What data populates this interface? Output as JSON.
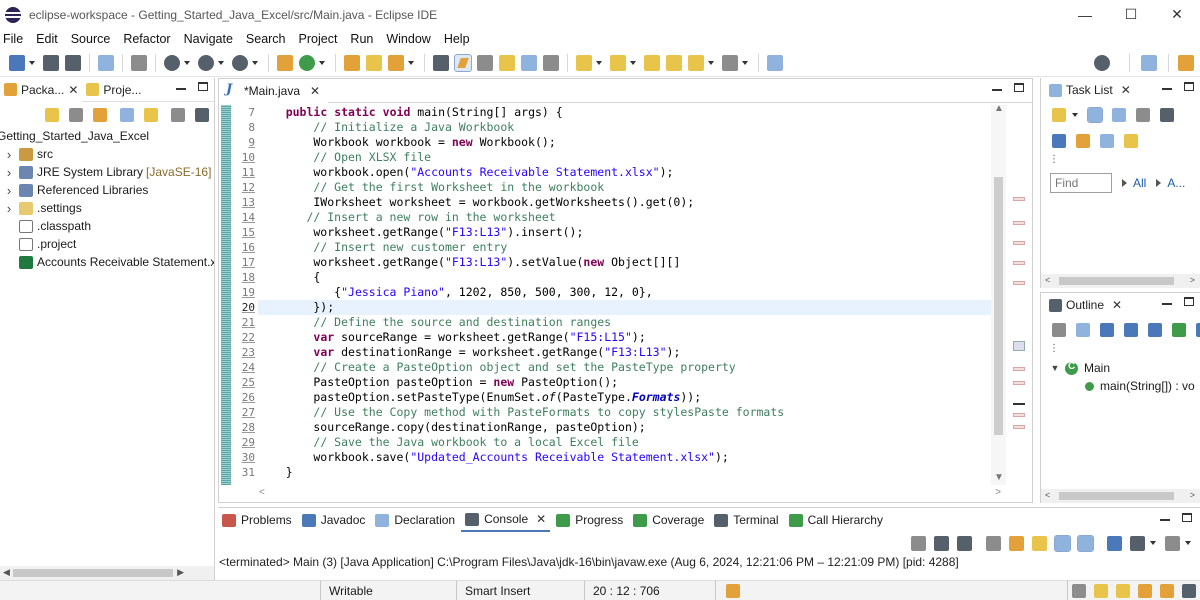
{
  "window": {
    "title": "eclipse-workspace - Getting_Started_Java_Excel/src/Main.java - Eclipse IDE",
    "minimize": "—",
    "maximize": "☐",
    "close": "✕"
  },
  "menu": [
    "File",
    "Edit",
    "Source",
    "Refactor",
    "Navigate",
    "Search",
    "Project",
    "Run",
    "Window",
    "Help"
  ],
  "left_panel": {
    "tabs": [
      {
        "label": "Packa...",
        "icon": "package-explorer-icon",
        "active": true
      },
      {
        "label": "Proje...",
        "icon": "project-explorer-icon",
        "active": false
      }
    ],
    "project": "Getting_Started_Java_Excel",
    "tree": [
      {
        "label": "src",
        "icon": "package-folder-icon",
        "extra": ""
      },
      {
        "label": "JRE System Library",
        "icon": "library-icon",
        "extra": "[JavaSE-16]"
      },
      {
        "label": "Referenced Libraries",
        "icon": "library-icon",
        "extra": ""
      },
      {
        "label": ".settings",
        "icon": "folder-icon",
        "extra": ""
      },
      {
        "label": ".classpath",
        "icon": "xml-file-icon",
        "extra": ""
      },
      {
        "label": ".project",
        "icon": "xml-file-icon",
        "extra": ""
      },
      {
        "label": "Accounts Receivable Statement.xl",
        "icon": "excel-file-icon",
        "extra": ""
      }
    ]
  },
  "editor": {
    "tab_label": "*Main.java",
    "current_line": 20,
    "lines": [
      {
        "n": "7",
        "t": [
          [
            "    ",
            ""
          ],
          [
            "public",
            "kw"
          ],
          [
            " ",
            ""
          ],
          [
            "static",
            "kw"
          ],
          [
            " ",
            ""
          ],
          [
            "void",
            "kw"
          ],
          [
            " main(String[] args) {",
            ""
          ]
        ]
      },
      {
        "n": "8",
        "t": [
          [
            "        ",
            ""
          ],
          [
            "// Initialize a Java Workbook",
            "cm"
          ]
        ]
      },
      {
        "n": "9",
        "t": [
          [
            "        Workbook workbook = ",
            ""
          ],
          [
            "new",
            "kw"
          ],
          [
            " Workbook();",
            ""
          ]
        ]
      },
      {
        "n": "10",
        "t": [
          [
            "        ",
            ""
          ],
          [
            "// Open XLSX file",
            "cm"
          ]
        ]
      },
      {
        "n": "11",
        "t": [
          [
            "        workbook.open(",
            ""
          ],
          [
            "\"Accounts Receivable Statement.xlsx\"",
            "st"
          ],
          [
            ");",
            ""
          ]
        ]
      },
      {
        "n": "12",
        "t": [
          [
            "        ",
            ""
          ],
          [
            "// Get the first Worksheet in the workbook",
            "cm"
          ]
        ]
      },
      {
        "n": "13",
        "t": [
          [
            "        IWorksheet worksheet = workbook.getWorksheets().get(0);",
            ""
          ]
        ]
      },
      {
        "n": "14",
        "t": [
          [
            "       ",
            ""
          ],
          [
            "// Insert a new row in the worksheet",
            "cm"
          ]
        ]
      },
      {
        "n": "15",
        "t": [
          [
            "        worksheet.getRange(",
            ""
          ],
          [
            "\"F13:L13\"",
            "st"
          ],
          [
            ").insert();",
            ""
          ]
        ]
      },
      {
        "n": "16",
        "t": [
          [
            "        ",
            ""
          ],
          [
            "// Insert new customer entry",
            "cm"
          ]
        ]
      },
      {
        "n": "17",
        "t": [
          [
            "        worksheet.getRange(",
            ""
          ],
          [
            "\"F13:L13\"",
            "st"
          ],
          [
            ").setValue(",
            ""
          ],
          [
            "new",
            "kw"
          ],
          [
            " Object[][]",
            ""
          ]
        ]
      },
      {
        "n": "18",
        "t": [
          [
            "        {",
            ""
          ]
        ]
      },
      {
        "n": "19",
        "t": [
          [
            "           {",
            ""
          ],
          [
            "\"Jessica Piano\"",
            "st"
          ],
          [
            ", 1202, 850, 500, 300, 12, 0},",
            ""
          ]
        ]
      },
      {
        "n": "20",
        "t": [
          [
            "        });",
            ""
          ]
        ]
      },
      {
        "n": "21",
        "t": [
          [
            "        ",
            ""
          ],
          [
            "// Define the source and destination ranges",
            "cm"
          ]
        ]
      },
      {
        "n": "22",
        "t": [
          [
            "        ",
            ""
          ],
          [
            "var",
            "kw"
          ],
          [
            " sourceRange = worksheet.getRange(",
            ""
          ],
          [
            "\"F15:L15\"",
            "st"
          ],
          [
            ");",
            ""
          ]
        ]
      },
      {
        "n": "23",
        "t": [
          [
            "        ",
            ""
          ],
          [
            "var",
            "kw"
          ],
          [
            " destinationRange = worksheet.getRange(",
            ""
          ],
          [
            "\"F13:L13\"",
            "st"
          ],
          [
            ");",
            ""
          ]
        ]
      },
      {
        "n": "24",
        "t": [
          [
            "        ",
            ""
          ],
          [
            "// Create a PasteOption object and set the PasteType property",
            "cm"
          ]
        ]
      },
      {
        "n": "25",
        "t": [
          [
            "        PasteOption pasteOption = ",
            ""
          ],
          [
            "new",
            "kw"
          ],
          [
            " PasteOption();",
            ""
          ]
        ]
      },
      {
        "n": "26",
        "t": [
          [
            "        pasteOption.setPasteType(EnumSet.",
            ""
          ],
          [
            "of",
            "it"
          ],
          [
            "(PasteType.",
            ""
          ],
          [
            "Formats",
            "fld"
          ],
          [
            "));",
            ""
          ]
        ]
      },
      {
        "n": "27",
        "t": [
          [
            "        ",
            ""
          ],
          [
            "// Use the Copy method with PasteFormats to copy stylesPaste formats",
            "cm"
          ]
        ]
      },
      {
        "n": "28",
        "t": [
          [
            "        sourceRange.copy(destinationRange, pasteOption);",
            ""
          ]
        ]
      },
      {
        "n": "29",
        "t": [
          [
            "        ",
            ""
          ],
          [
            "// Save the Java workbook to a local Excel file",
            "cm"
          ]
        ]
      },
      {
        "n": "30",
        "t": [
          [
            "        workbook.save(",
            ""
          ],
          [
            "\"Updated_Accounts Receivable Statement.xlsx\"",
            "st"
          ],
          [
            ");",
            ""
          ]
        ]
      },
      {
        "n": "31",
        "t": [
          [
            "    }",
            ""
          ]
        ]
      }
    ]
  },
  "task_list": {
    "tab_label": "Task List",
    "find_placeholder": "Find",
    "all_link": "All",
    "activate_link": "A..."
  },
  "outline": {
    "tab_label": "Outline",
    "class_name": "Main",
    "method": "main(String[]) : vo"
  },
  "console": {
    "tabs": [
      {
        "label": "Problems",
        "icon": "problems-icon",
        "active": false
      },
      {
        "label": "Javadoc",
        "icon": "javadoc-icon",
        "active": false
      },
      {
        "label": "Declaration",
        "icon": "declaration-icon",
        "active": false
      },
      {
        "label": "Console",
        "icon": "console-icon",
        "active": true
      },
      {
        "label": "Progress",
        "icon": "progress-icon",
        "active": false
      },
      {
        "label": "Coverage",
        "icon": "coverage-icon",
        "active": false
      },
      {
        "label": "Terminal",
        "icon": "terminal-icon",
        "active": false
      },
      {
        "label": "Call Hierarchy",
        "icon": "call-hierarchy-icon",
        "active": false
      }
    ],
    "output": "<terminated> Main (3) [Java Application] C:\\Program Files\\Java\\jdk-16\\bin\\javaw.exe  (Aug 6, 2024, 12:21:06 PM – 12:21:09 PM) [pid: 4288]"
  },
  "status": {
    "writable": "Writable",
    "insert_mode": "Smart Insert",
    "position": "20 : 12 : 706"
  },
  "colors": {
    "keyword": "#7f0055",
    "comment": "#3f7f5f",
    "string": "#2a00ff",
    "current_line": "#e8f2fe"
  }
}
